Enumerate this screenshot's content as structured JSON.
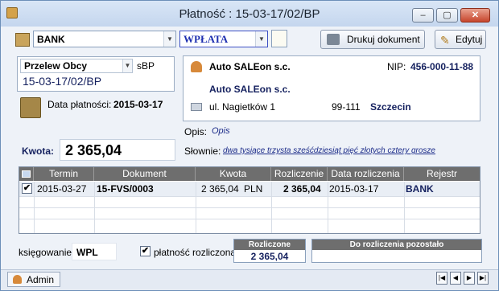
{
  "window": {
    "title": "Płatność : 15-03-17/02/BP"
  },
  "toolbar": {
    "register_value": "BANK",
    "type_value": "WPŁATA",
    "print_label": "Drukuj dokument",
    "edit_label": "Edytuj"
  },
  "payment": {
    "method_value": "Przelew Obcy",
    "doc_symbol": "sBP",
    "number": "15-03-17/02/BP",
    "date_label": "Data płatności:",
    "date_value": "2015-03-17",
    "amount_label": "Kwota:",
    "amount_value": "2 365,04"
  },
  "contractor": {
    "name": "Auto SALEon s.c.",
    "nip_label": "NIP:",
    "nip_value": "456-000-11-88",
    "full_name": "Auto SALEon s.c.",
    "street": "ul. Nagietków 1",
    "postal": "99-111",
    "city": "Szczecin"
  },
  "description": {
    "label": "Opis:",
    "value": "Opis",
    "words_label": "Słownie:",
    "words_value": "dwa tysiące trzysta sześćdziesiąt pięć złotych cztery grosze"
  },
  "table": {
    "columns": [
      "Termin",
      "Dokument",
      "Kwota",
      "Rozliczenie",
      "Data rozliczenia",
      "Rejestr"
    ],
    "rows": [
      {
        "checked": "✔",
        "termin": "2015-03-27",
        "dokument": "15-FVS/0003",
        "kwota": "2 365,04",
        "waluta": "PLN",
        "rozliczenie": "2 365,04",
        "data_rozliczenia": "2015-03-17",
        "rejestr": "BANK"
      }
    ]
  },
  "footer": {
    "ksiegowanie_label": "księgowanie:",
    "ksiegowanie_value": "WPL",
    "settled_checkbox_label": "płatność rozliczona",
    "settled_checked": "✔",
    "rozliczone_label": "Rozliczone",
    "rozliczone_value": "2 365,04",
    "pozostalo_label": "Do rozliczenia pozostało",
    "pozostalo_value": ""
  },
  "status": {
    "user": "Admin"
  },
  "colors": {
    "header_bg": "#6e6e6e",
    "accent_navy": "#15215f",
    "type_blue": "#1e2fb0"
  }
}
